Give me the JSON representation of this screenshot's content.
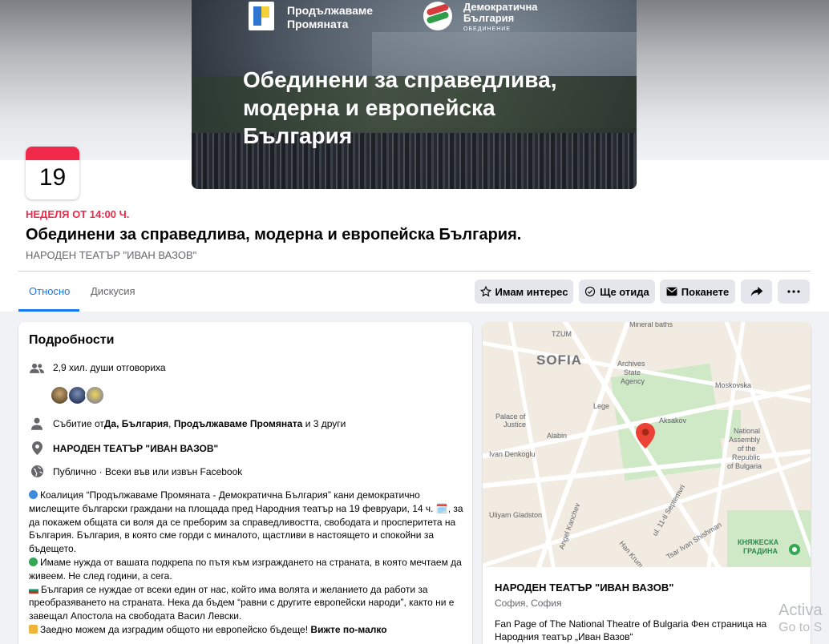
{
  "cover": {
    "logo1_line1": "Продължаваме",
    "logo1_line2": "Промяната",
    "logo2_line1": "Демократична",
    "logo2_line2": "България",
    "logo2_sub": "ОБЕДИНЕНИЕ",
    "title_line1": "Обединени за справедлива,",
    "title_line2": "модерна и европейска",
    "title_line3": "България"
  },
  "event": {
    "calendar_day": "19",
    "date_text": "НЕДЕЛЯ ОТ 14:00 Ч.",
    "title": "Обединени за справедлива, модерна и европейска България.",
    "venue": "НАРОДЕН ТЕАТЪР \"ИВАН ВАЗОВ\""
  },
  "tabs": {
    "about": "Относно",
    "discussion": "Дискусия"
  },
  "actions": {
    "interested": "Имам интерес",
    "going": "Ще отида",
    "invite": "Поканете"
  },
  "details": {
    "heading": "Подробности",
    "responded": "2,9 хил. души отговориха",
    "event_by_prefix": "Събитие от ",
    "host1": "Да, България",
    "host_sep": ", ",
    "host2": "Продължаваме Промяната",
    "others": " и 3 други",
    "location": "НАРОДЕН ТЕАТЪР \"ИВАН ВАЗОВ\"",
    "privacy": "Публично · Всеки във или извън Facebook",
    "p1": "Коалиция “Продължаваме Промяната - Демократична България” кани демократично мислещите български граждани на площада пред Народния театър на 19 февруари, 14 ч. 🗓️, за да покажем общата си воля да се преборим за справедливостта, свободата и просперитета на България. България, в която сме горди с миналото, щастливи в настоящето и спокойни за бъдещето.",
    "p2": "Имаме нужда от вашата подкрепа по пътя към изграждането на страната, в която мечтаем да живеем. Не след години, а сега.",
    "p3": "България се нуждае от всеки един от нас, който има волята и желанието да работи за преобразяването на страната. Нека да бъдем “равни с другите европейски народи”, както ни е завещал Апостола на свободата Васил Левски.",
    "p4": "Заедно можем да изградим общото ни европейско бъдеще!",
    "see_less": "Вижте по-малко"
  },
  "map": {
    "city": "SOFIA",
    "labels": {
      "tzum": "TZUM",
      "mineral": "Mineral baths",
      "archives": "Archives",
      "state": "State",
      "agency": "Agency",
      "moskovska": "Moskovska",
      "palace1": "Palace of",
      "palace2": "Justice",
      "alabin": "Alabin",
      "legge": "Lege",
      "aksakov": "Aksakov",
      "national1": "National",
      "national2": "Assembly",
      "national3": "of the",
      "national4": "Republic",
      "national5": "of Bulgaria",
      "ivan_denkoglu": "Ivan Denkoglu",
      "sept": "ul. 11-ti Septemvri",
      "gladston": "Uliyam Gladston",
      "kanchev": "Angel Kanchev",
      "han": "Han Krum",
      "shishman": "Tsar Ivan Shishman",
      "garden1": "КНЯЖЕСКА",
      "garden2": "ГРАДИНА"
    }
  },
  "venue_card": {
    "name": "НАРОДЕН ТЕАТЪР \"ИВАН ВАЗОВ\"",
    "city": "София, София",
    "desc": "Fan Page of The National Theatre of Bulgaria Фен страница на Народния театър „Иван Вазов“"
  },
  "watermark": {
    "line1": "Activa",
    "line2": "Go to S"
  },
  "colors": {
    "accent": "#1877f2",
    "event_red": "#f02849",
    "button_bg": "#e4e6eb"
  }
}
